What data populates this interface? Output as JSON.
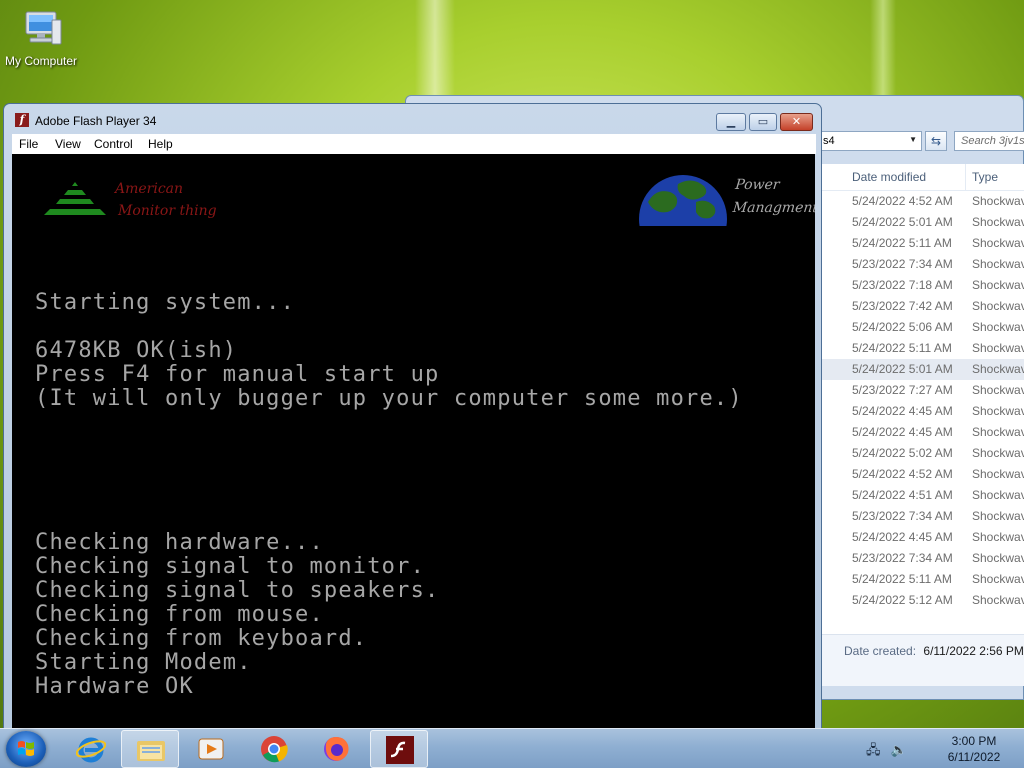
{
  "desktop": {
    "icons": [
      {
        "label": "My Computer",
        "icon": "computer-icon"
      }
    ]
  },
  "explorer": {
    "address_value": "s4",
    "search_placeholder": "Search 3jv1s",
    "columns": [
      "Date modified",
      "Type"
    ],
    "rows": [
      {
        "date": "5/24/2022 4:52 AM",
        "type": "Shockwav"
      },
      {
        "date": "5/24/2022 5:01 AM",
        "type": "Shockwav"
      },
      {
        "date": "5/24/2022 5:11 AM",
        "type": "Shockwav"
      },
      {
        "date": "5/23/2022 7:34 AM",
        "type": "Shockwav"
      },
      {
        "date": "5/23/2022 7:18 AM",
        "type": "Shockwav"
      },
      {
        "date": "5/23/2022 7:42 AM",
        "type": "Shockwav"
      },
      {
        "date": "5/24/2022 5:06 AM",
        "type": "Shockwav"
      },
      {
        "date": "5/24/2022 5:11 AM",
        "type": "Shockwav"
      },
      {
        "date": "5/24/2022 5:01 AM",
        "type": "Shockwav",
        "selected": true
      },
      {
        "date": "5/23/2022 7:27 AM",
        "type": "Shockwav"
      },
      {
        "date": "5/24/2022 4:45 AM",
        "type": "Shockwav"
      },
      {
        "date": "5/24/2022 4:45 AM",
        "type": "Shockwav"
      },
      {
        "date": "5/24/2022 5:02 AM",
        "type": "Shockwav"
      },
      {
        "date": "5/24/2022 4:52 AM",
        "type": "Shockwav"
      },
      {
        "date": "5/24/2022 4:51 AM",
        "type": "Shockwav"
      },
      {
        "date": "5/23/2022 7:34 AM",
        "type": "Shockwav"
      },
      {
        "date": "5/24/2022 4:45 AM",
        "type": "Shockwav"
      },
      {
        "date": "5/23/2022 7:34 AM",
        "type": "Shockwav"
      },
      {
        "date": "5/24/2022 5:11 AM",
        "type": "Shockwav"
      },
      {
        "date": "5/24/2022 5:12 AM",
        "type": "Shockwav"
      }
    ],
    "details": {
      "label": "Date created:",
      "value": "6/11/2022 2:56 PM"
    }
  },
  "flash": {
    "title": "Adobe Flash Player 34",
    "menu": [
      "File",
      "View",
      "Control",
      "Help"
    ],
    "logo_left_line1": "American",
    "logo_left_line2": "Monitor thing",
    "logo_right_line1": "Power",
    "logo_right_line2": "Managment",
    "console": {
      "line1": "Starting system...",
      "line2": "6478KB OK(ish)",
      "line3": "Press F4 for manual start up",
      "line4": "(It will only bugger up your computer some more.)",
      "line5": "Checking hardware...",
      "line6": "Checking signal to monitor.",
      "line7": "Checking signal to speakers.",
      "line8": "Checking from mouse.",
      "line9": "Checking from keyboard.",
      "line10": "Starting Modem.",
      "line11": "Hardware OK"
    }
  },
  "taskbar": {
    "apps": [
      "internet-explorer-icon",
      "folder-icon",
      "media-player-icon",
      "chrome-icon",
      "firefox-icon",
      "flash-player-icon"
    ],
    "active_app": "flash-player-icon",
    "clock_time": "3:00 PM",
    "clock_date": "6/11/2022"
  },
  "colors": {
    "console_text": "#a6a6a6",
    "brand_red": "#8a1616",
    "logo_green": "#1f8a1f"
  }
}
